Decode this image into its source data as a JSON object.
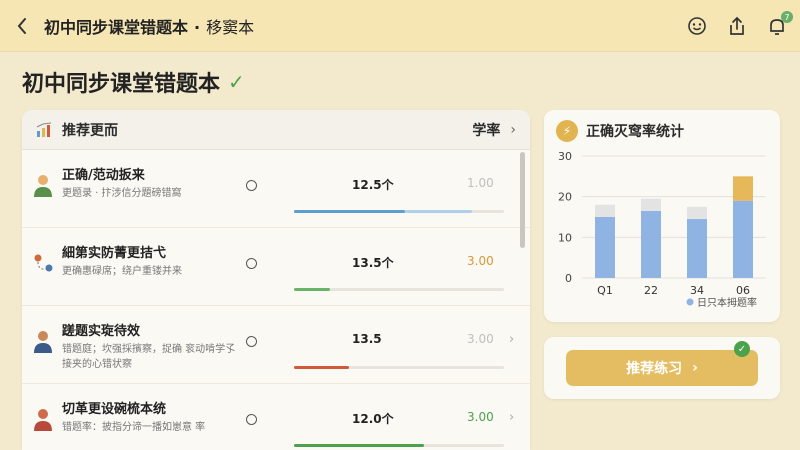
{
  "topbar": {
    "title": "初中同步课堂错题本",
    "separator": "·",
    "subtitle": "移窦本"
  },
  "page": {
    "title": "初中同步课堂错题本"
  },
  "list_card": {
    "header_label": "推荐更而",
    "header_right": "学率",
    "rows": [
      {
        "title": "正确/范动扳来",
        "subtitle": "更题录 · 抃涉信分題磅错窩",
        "count": "12.5个",
        "score": "1.00",
        "score_color": "#bfbfbf",
        "progress": 0.53,
        "bar_color": "#5b9fcf",
        "bar_color2": "#aed0ea"
      },
      {
        "title": "細第实防菁更拮弋",
        "subtitle": "更确惠碌席；绕户重镂并来",
        "count": "13.5个",
        "score": "3.00",
        "score_color": "#d39a3a",
        "progress": 0.17,
        "bar_color": "#6ab46a",
        "bar_color2": null
      },
      {
        "title": "蹉题实琁待效",
        "subtitle": "错题庭；坎强採擯察，捉确 衮动啃学孓接夹的心错状察",
        "count": "13.5",
        "score": "3.00",
        "score_color": "#bfbfbf",
        "progress": 0.26,
        "bar_color": "#cf5a3a",
        "bar_color2": null
      },
      {
        "title": "切革更设碗梳本统",
        "subtitle": "错题率：披指分谛一播如崽意 率",
        "count": "12.0个",
        "score": "3.00",
        "score_color": "#4ca24c",
        "progress": 0.62,
        "bar_color": "#4ca24c",
        "bar_color2": null
      }
    ]
  },
  "chart_card": {
    "title": "正确灭窎率统计"
  },
  "chart_data": {
    "type": "bar",
    "categories": [
      "Q1",
      "22",
      "34",
      "06"
    ],
    "series": [
      {
        "values": [
          15,
          16.5,
          14.5,
          19
        ],
        "color": "#8fb3e3"
      },
      {
        "values": [
          3,
          3,
          3,
          6
        ],
        "color": "#e3e3e3",
        "highlight_color": "#e6b85a"
      }
    ],
    "ylim": [
      0,
      30
    ],
    "yticks": [
      "0",
      "10",
      "20",
      "30"
    ],
    "ytick_values": [
      0,
      10,
      20,
      30
    ],
    "legend": "日只本拇题率",
    "legend_placement": "bottom-right",
    "grid": true
  },
  "action_card": {
    "button_label": "推荐练习",
    "button_arrow": "›"
  },
  "icons": {
    "back": "chevron-left-icon",
    "emoji": "smile-icon",
    "share": "share-icon",
    "notification": "bell-icon",
    "notification_count": "7"
  }
}
